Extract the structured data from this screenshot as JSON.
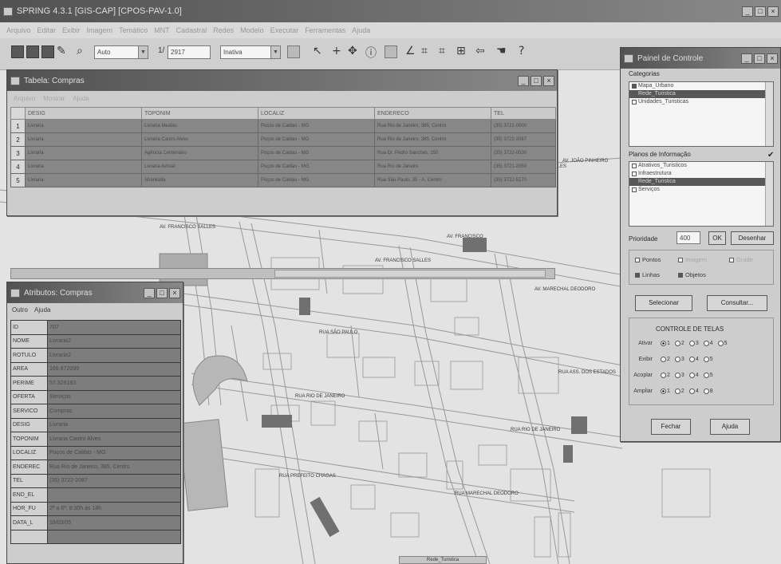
{
  "app": {
    "title": "SPRING 4.3.1 [GIS-CAP] [CPOS-PAV-1.0]",
    "menu": [
      "Arquivo",
      "Editar",
      "Exibir",
      "Imagem",
      "Temático",
      "MNT",
      "Cadastral",
      "Redes",
      "Modelo",
      "Executar",
      "Ferramentas",
      "Ajuda"
    ]
  },
  "toolbar": {
    "scale_prefix": "1/",
    "scale_value": "2917",
    "auto_label": "Auto",
    "mode_label": "Inativa"
  },
  "tabela": {
    "title": "Tabela: Compras",
    "menu": [
      "Arquivo",
      "Mostrar",
      "Ajuda"
    ],
    "columns": [
      "DESIG",
      "TOPONIM",
      "LOCALIZ",
      "ENDERECO",
      "TEL"
    ],
    "rows": [
      {
        "num": "1",
        "desig": "Livraria",
        "toponim": "Livraria Idealas",
        "localiz": "Poços de Caldas - MG",
        "endereco": "Rua Rio de Janeiro, 385, Centro",
        "tel": "(35) 3721-0000"
      },
      {
        "num": "2",
        "desig": "Livraria",
        "toponim": "Livraria Castro Alves",
        "localiz": "Poços de Caldas - MG",
        "endereco": "Rua Rio de Janeiro, 385, Centro",
        "tel": "(35) 3722-2087"
      },
      {
        "num": "3",
        "desig": "Livraria",
        "toponim": "Agência Centenário",
        "localiz": "Poços de Caldas - MG",
        "endereco": "Rua Dr. Pedro Sanches, 150",
        "tel": "(35) 3722-0530"
      },
      {
        "num": "4",
        "desig": "Livraria",
        "toponim": "Livraria Avistal",
        "localiz": "Poços de Caldas - MG",
        "endereco": "Rua Rio de Janeiro",
        "tel": "(35) 3721-2050"
      },
      {
        "num": "5",
        "desig": "Livraria",
        "toponim": "Shankalla",
        "localiz": "Poços de Caldas - MG",
        "endereco": "Rua São Paulo, 35 - A, Centro",
        "tel": "(35) 3722-5170"
      }
    ]
  },
  "atributos": {
    "title": "Atributos: Compras",
    "menu": [
      "Outro",
      "Ajuda"
    ],
    "rows": [
      {
        "key": "ID",
        "value": "707"
      },
      {
        "key": "NOME",
        "value": "Livraria2"
      },
      {
        "key": "ROTULO",
        "value": "Livraria2"
      },
      {
        "key": "AREA",
        "value": "169.872099"
      },
      {
        "key": "PERIME",
        "value": "57.328183"
      },
      {
        "key": "OFERTA",
        "value": "Serviços"
      },
      {
        "key": "SERVICO",
        "value": "Compras"
      },
      {
        "key": "DESIG",
        "value": "Livraria"
      },
      {
        "key": "TOPONIM",
        "value": "Livraria Castro Alves"
      },
      {
        "key": "LOCALIZ",
        "value": "Poços de Caldas - MG"
      },
      {
        "key": "ENDEREC",
        "value": "Rua Rio de Janeiro, 385, Centro"
      },
      {
        "key": "TEL",
        "value": "(35) 3722-2087"
      },
      {
        "key": "END_EL",
        "value": ""
      },
      {
        "key": "HOR_FU",
        "value": "2ª a 6ª: 8:30h às 18h"
      },
      {
        "key": "DATA_L",
        "value": "18/03/05"
      },
      {
        "key": "",
        "value": ""
      }
    ]
  },
  "painel": {
    "title": "Painel de Controle",
    "categorias_label": "Categorias",
    "categorias": [
      {
        "label": "Mapa_Urbano",
        "checked": true,
        "selected": false
      },
      {
        "label": "Rede_Turistica",
        "checked": true,
        "selected": true
      },
      {
        "label": "Unidades_Turisticas",
        "checked": false,
        "selected": false
      }
    ],
    "planos_label": "Planos de Informação",
    "planos": [
      {
        "label": "Atrativos_Turisticos",
        "checked": false,
        "selected": false
      },
      {
        "label": "Infraestrutura",
        "checked": false,
        "selected": false
      },
      {
        "label": "Rede_Turistica",
        "checked": true,
        "selected": true
      },
      {
        "label": "Serviços",
        "checked": false,
        "selected": false
      }
    ],
    "prioridade_label": "Prioridade",
    "prioridade_value": "400",
    "ok_label": "OK",
    "desenhar_label": "Desenhar",
    "check_pontos": "Pontos",
    "check_imagem": "Imagem",
    "check_grade": "Grade",
    "check_linhas": "Linhas",
    "check_objetos": "Objetos",
    "selecionar_label": "Selecionar",
    "consultar_label": "Consultar...",
    "controle_title": "CONTROLE DE TELAS",
    "ctrl_rows": [
      {
        "label": "Ativar",
        "options": [
          "1",
          "2",
          "3",
          "4",
          "5"
        ],
        "selected": 0
      },
      {
        "label": "Exibir",
        "options": [
          "2",
          "3",
          "4",
          "5"
        ],
        "selected": -1
      },
      {
        "label": "Acoplar",
        "options": [
          "2",
          "3",
          "4",
          "5"
        ],
        "selected": -1
      },
      {
        "label": "Ampliar",
        "options": [
          "1",
          "2",
          "4",
          "8"
        ],
        "selected": 0
      }
    ],
    "fechar_label": "Fechar",
    "ajuda_label": "Ajuda"
  },
  "status_tab": "Rede_Turistica"
}
